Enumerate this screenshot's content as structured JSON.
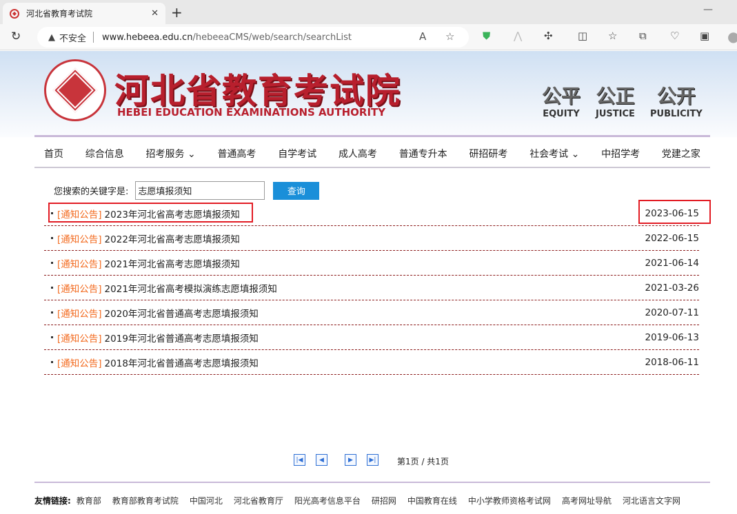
{
  "browser": {
    "tab_title": "河北省教育考试院",
    "security": "不安全",
    "url_host": "www.hebeea.edu.cn",
    "url_path": "/hebeeaCMS/web/search/searchList"
  },
  "header": {
    "title": "河北省教育考试院",
    "subtitle": "HEBEI EDUCATION EXAMINATIONS AUTHORITY",
    "mottos": [
      {
        "cn": "公平",
        "en": "EQUITY"
      },
      {
        "cn": "公正",
        "en": "JUSTICE"
      },
      {
        "cn": "公开",
        "en": "PUBLICITY"
      }
    ]
  },
  "nav": [
    {
      "label": "首页"
    },
    {
      "label": "综合信息"
    },
    {
      "label": "招考服务 ⌄"
    },
    {
      "label": "普通高考"
    },
    {
      "label": "自学考试"
    },
    {
      "label": "成人高考"
    },
    {
      "label": "普通专升本"
    },
    {
      "label": "研招研考"
    },
    {
      "label": "社会考试 ⌄"
    },
    {
      "label": "中招学考"
    },
    {
      "label": "党建之家"
    }
  ],
  "search": {
    "label": "您搜索的关键字是:",
    "value": "志愿填报须知",
    "button": "查询"
  },
  "results": [
    {
      "tag": "[通知公告]",
      "title": "2023年河北省高考志愿填报须知",
      "date": "2023-06-15"
    },
    {
      "tag": "[通知公告]",
      "title": "2022年河北省高考志愿填报须知",
      "date": "2022-06-15"
    },
    {
      "tag": "[通知公告]",
      "title": "2021年河北省高考志愿填报须知",
      "date": "2021-06-14"
    },
    {
      "tag": "[通知公告]",
      "title": "2021年河北省高考模拟演练志愿填报须知",
      "date": "2021-03-26"
    },
    {
      "tag": "[通知公告]",
      "title": "2020年河北省普通高考志愿填报须知",
      "date": "2020-07-11"
    },
    {
      "tag": "[通知公告]",
      "title": "2019年河北省普通高考志愿填报须知",
      "date": "2019-06-13"
    },
    {
      "tag": "[通知公告]",
      "title": "2018年河北省普通高考志愿填报须知",
      "date": "2018-06-11"
    }
  ],
  "pagination": {
    "info": "第1页 / 共1页",
    "current": 1,
    "total": 1
  },
  "footer": {
    "label": "友情链接:",
    "links": [
      "教育部",
      "教育部教育考试院",
      "中国河北",
      "河北省教育厅",
      "阳光高考信息平台",
      "研招网",
      "中国教育在线",
      "中小学教师资格考试网",
      "高考网址导航",
      "河北语言文字网"
    ]
  },
  "colors": {
    "accent": "#1a8fd9",
    "tag": "#f36a1e",
    "highlight": "#e21b23",
    "brand": "#b81f2d"
  }
}
